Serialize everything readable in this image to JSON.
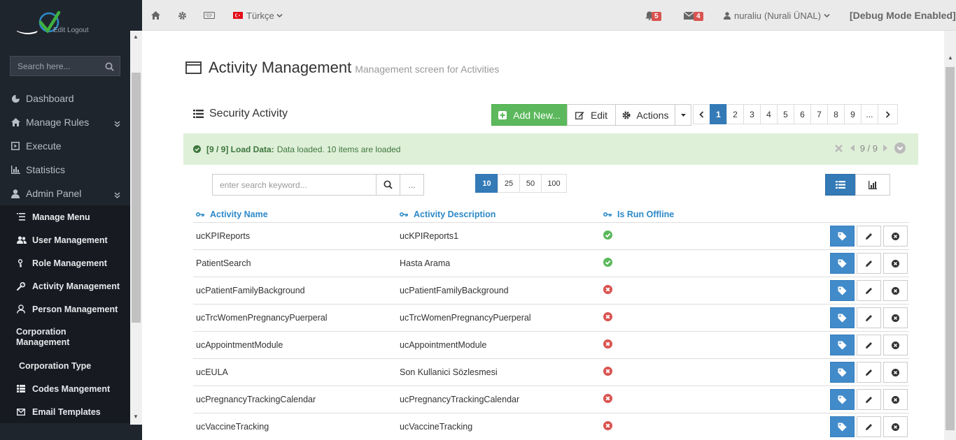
{
  "sidebar": {
    "logo_links": "Edit  Logout",
    "search_placeholder": "Search here...",
    "menu": [
      {
        "label": "Dashboard",
        "icon": "dashboard-icon"
      },
      {
        "label": "Manage Rules",
        "icon": "home-icon"
      },
      {
        "label": "Execute",
        "icon": "execute-icon"
      },
      {
        "label": "Statistics",
        "icon": "chart-icon"
      },
      {
        "label": "Admin Panel",
        "icon": "user-icon"
      }
    ],
    "submenu": [
      {
        "label": "Manage Menu",
        "icon": "list-icon"
      },
      {
        "label": "User Management",
        "icon": "users-icon"
      },
      {
        "label": "Role Management",
        "icon": "key-icon"
      },
      {
        "label": "Activity Management",
        "icon": "wrench-icon"
      },
      {
        "label": "Person Management",
        "icon": "person-icon"
      },
      {
        "label": "Corporation Management",
        "icon": ""
      },
      {
        "label": "Corporation Type",
        "icon": ""
      },
      {
        "label": "Codes Mangement",
        "icon": "grid-icon"
      },
      {
        "label": "Email Templates",
        "icon": "envelope-icon"
      }
    ]
  },
  "topbar": {
    "language": "Türkçe",
    "notifications_count": "5",
    "messages_count": "4",
    "user": "nuraliu",
    "user_full": "(Nurali ÜNAL)",
    "debug": "[Debug Mode Enabled]"
  },
  "page": {
    "title": "Activity Management",
    "subtitle": "Management screen for Activities",
    "portlet_title": "Security Activity"
  },
  "toolbar": {
    "add_label": "Add New...",
    "edit_label": "Edit",
    "actions_label": "Actions"
  },
  "pager": {
    "pages": [
      "1",
      "2",
      "3",
      "4",
      "5",
      "6",
      "7",
      "8",
      "9",
      "..."
    ],
    "current": "1"
  },
  "alert": {
    "prefix": "[9 / 9] Load Data:",
    "message": "Data loaded. 10 items are loaded",
    "counter": "9 / 9"
  },
  "search": {
    "placeholder": "enter search keyword...",
    "more_label": "..."
  },
  "page_sizes": [
    "10",
    "25",
    "50",
    "100"
  ],
  "table": {
    "columns": [
      "Activity Name",
      "Activity Description",
      "Is Run Offline"
    ],
    "rows": [
      {
        "name": "ucKPIReports",
        "desc": "ucKPIReports1",
        "offline": true
      },
      {
        "name": "PatientSearch",
        "desc": "Hasta Arama",
        "offline": true
      },
      {
        "name": "ucPatientFamilyBackground",
        "desc": "ucPatientFamilyBackground",
        "offline": false
      },
      {
        "name": "ucTrcWomenPregnancyPuerperal",
        "desc": "ucTrcWomenPregnancyPuerperal",
        "offline": false
      },
      {
        "name": "ucAppointmentModule",
        "desc": "ucAppointmentModule",
        "offline": false
      },
      {
        "name": "ucEULA",
        "desc": "Son Kullanici Sözlesmesi",
        "offline": false
      },
      {
        "name": "ucPregnancyTrackingCalendar",
        "desc": "ucPregnancyTrackingCalendar",
        "offline": false
      },
      {
        "name": "ucVaccineTracking",
        "desc": "ucVaccineTracking",
        "offline": false
      }
    ]
  },
  "colors": {
    "accent": "#337ab7",
    "success": "#5cb85c",
    "danger": "#d9534f",
    "sidebar_bg": "#1f252d"
  }
}
